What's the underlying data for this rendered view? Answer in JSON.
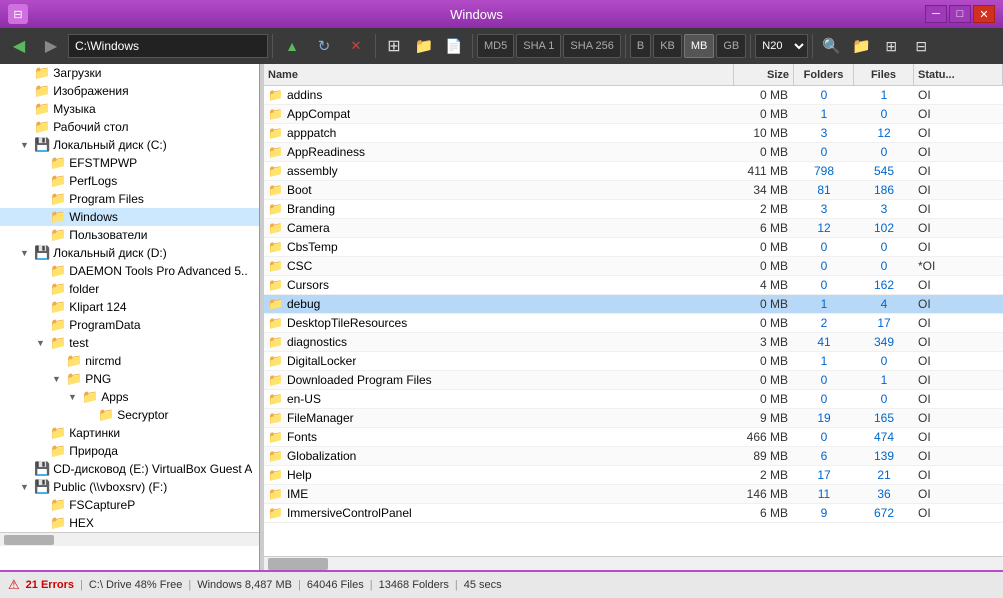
{
  "titlebar": {
    "title": "Windows",
    "min_btn": "─",
    "max_btn": "□",
    "close_btn": "✕"
  },
  "toolbar": {
    "address": "C:\\Windows",
    "back_icon": "◀",
    "forward_icon": "▶",
    "up_icon": "▲",
    "refresh_icon": "↻",
    "cancel_icon": "✕",
    "calc_icon": "▦",
    "folder_icon": "📁",
    "file_icon": "📄",
    "hash_md5": "MD5",
    "hash_sha1": "SHA 1",
    "hash_sha256": "SHA 256",
    "unit_b": "B",
    "unit_kb": "KB",
    "unit_mb": "MB",
    "unit_gb": "GB",
    "size_select": "N20",
    "search_icon": "🔍",
    "view1_icon": "⊞",
    "view2_icon": "≡",
    "view3_icon": "⊟"
  },
  "tree": {
    "items": [
      {
        "id": "downloads",
        "label": "Загрузки",
        "indent": 1,
        "arrow": "",
        "has_arrow": false
      },
      {
        "id": "images",
        "label": "Изображения",
        "indent": 1,
        "arrow": "",
        "has_arrow": false
      },
      {
        "id": "music",
        "label": "Музыка",
        "indent": 1,
        "arrow": "",
        "has_arrow": false
      },
      {
        "id": "desktop",
        "label": "Рабочий стол",
        "indent": 1,
        "arrow": "",
        "has_arrow": false
      },
      {
        "id": "local-c",
        "label": "Локальный диск (C:)",
        "indent": 1,
        "arrow": "▼",
        "has_arrow": true
      },
      {
        "id": "efstmpwp",
        "label": "EFSTMPWP",
        "indent": 2,
        "arrow": "",
        "has_arrow": false
      },
      {
        "id": "perflogs",
        "label": "PerfLogs",
        "indent": 2,
        "arrow": "",
        "has_arrow": false
      },
      {
        "id": "program-files",
        "label": "Program Files",
        "indent": 2,
        "arrow": "",
        "has_arrow": false
      },
      {
        "id": "windows",
        "label": "Windows",
        "indent": 2,
        "arrow": "",
        "has_arrow": false
      },
      {
        "id": "users",
        "label": "Пользователи",
        "indent": 2,
        "arrow": "",
        "has_arrow": false
      },
      {
        "id": "local-d",
        "label": "Локальный диск (D:)",
        "indent": 1,
        "arrow": "▼",
        "has_arrow": true
      },
      {
        "id": "daemon",
        "label": "DAEMON Tools Pro Advanced 5..",
        "indent": 2,
        "arrow": "",
        "has_arrow": false
      },
      {
        "id": "folder",
        "label": "folder",
        "indent": 2,
        "arrow": "",
        "has_arrow": false
      },
      {
        "id": "klipart",
        "label": "Klipart 124",
        "indent": 2,
        "arrow": "",
        "has_arrow": false
      },
      {
        "id": "programdata",
        "label": "ProgramData",
        "indent": 2,
        "arrow": "",
        "has_arrow": false
      },
      {
        "id": "test",
        "label": "test",
        "indent": 2,
        "arrow": "▼",
        "has_arrow": true
      },
      {
        "id": "nircmd",
        "label": "nircmd",
        "indent": 3,
        "arrow": "",
        "has_arrow": false
      },
      {
        "id": "png",
        "label": "PNG",
        "indent": 3,
        "arrow": "▼",
        "has_arrow": true
      },
      {
        "id": "apps",
        "label": "Apps",
        "indent": 4,
        "arrow": "▼",
        "has_arrow": true
      },
      {
        "id": "secryptor",
        "label": "Secryptor",
        "indent": 5,
        "arrow": "",
        "has_arrow": false
      },
      {
        "id": "kartinki",
        "label": "Картинки",
        "indent": 2,
        "arrow": "",
        "has_arrow": false
      },
      {
        "id": "priroda",
        "label": "Природа",
        "indent": 2,
        "arrow": "",
        "has_arrow": false
      },
      {
        "id": "cd-drive",
        "label": "CD-дисковод (E:) VirtualBox Guest A",
        "indent": 1,
        "arrow": "",
        "has_arrow": false
      },
      {
        "id": "public",
        "label": "Public (\\\\vboxsrv) (F:)",
        "indent": 1,
        "arrow": "▼",
        "has_arrow": true
      },
      {
        "id": "fscapturep",
        "label": "FSCaptureP",
        "indent": 2,
        "arrow": "",
        "has_arrow": false
      },
      {
        "id": "hex",
        "label": "HEX",
        "indent": 2,
        "arrow": "",
        "has_arrow": false
      }
    ]
  },
  "file_header": {
    "name": "Name",
    "size": "Size",
    "folders": "Folders",
    "files": "Files",
    "status": "Statu..."
  },
  "files": [
    {
      "name": "addins",
      "size": "0 MB",
      "folders": "0",
      "files": "1",
      "status": "OI",
      "selected": false
    },
    {
      "name": "AppCompat",
      "size": "0 MB",
      "folders": "1",
      "files": "0",
      "status": "OI",
      "selected": false
    },
    {
      "name": "apppatch",
      "size": "10 MB",
      "folders": "3",
      "files": "12",
      "status": "OI",
      "selected": false
    },
    {
      "name": "AppReadiness",
      "size": "0 MB",
      "folders": "0",
      "files": "0",
      "status": "OI",
      "selected": false
    },
    {
      "name": "assembly",
      "size": "411 MB",
      "folders": "798",
      "files": "545",
      "status": "OI",
      "selected": false
    },
    {
      "name": "Boot",
      "size": "34 MB",
      "folders": "81",
      "files": "186",
      "status": "OI",
      "selected": false
    },
    {
      "name": "Branding",
      "size": "2 MB",
      "folders": "3",
      "files": "3",
      "status": "OI",
      "selected": false
    },
    {
      "name": "Camera",
      "size": "6 MB",
      "folders": "12",
      "files": "102",
      "status": "OI",
      "selected": false
    },
    {
      "name": "CbsTemp",
      "size": "0 MB",
      "folders": "0",
      "files": "0",
      "status": "OI",
      "selected": false
    },
    {
      "name": "CSC",
      "size": "0 MB",
      "folders": "0",
      "files": "0",
      "status": "*OI",
      "selected": false
    },
    {
      "name": "Cursors",
      "size": "4 MB",
      "folders": "0",
      "files": "162",
      "status": "OI",
      "selected": false
    },
    {
      "name": "debug",
      "size": "0 MB",
      "folders": "1",
      "files": "4",
      "status": "OI",
      "selected": true
    },
    {
      "name": "DesktopTileResources",
      "size": "0 MB",
      "folders": "2",
      "files": "17",
      "status": "OI",
      "selected": false
    },
    {
      "name": "diagnostics",
      "size": "3 MB",
      "folders": "41",
      "files": "349",
      "status": "OI",
      "selected": false
    },
    {
      "name": "DigitalLocker",
      "size": "0 MB",
      "folders": "1",
      "files": "0",
      "status": "OI",
      "selected": false
    },
    {
      "name": "Downloaded Program Files",
      "size": "0 MB",
      "folders": "0",
      "files": "1",
      "status": "OI",
      "selected": false
    },
    {
      "name": "en-US",
      "size": "0 MB",
      "folders": "0",
      "files": "0",
      "status": "OI",
      "selected": false
    },
    {
      "name": "FileManager",
      "size": "9 MB",
      "folders": "19",
      "files": "165",
      "status": "OI",
      "selected": false
    },
    {
      "name": "Fonts",
      "size": "466 MB",
      "folders": "0",
      "files": "474",
      "status": "OI",
      "selected": false
    },
    {
      "name": "Globalization",
      "size": "89 MB",
      "folders": "6",
      "files": "139",
      "status": "OI",
      "selected": false
    },
    {
      "name": "Help",
      "size": "2 MB",
      "folders": "17",
      "files": "21",
      "status": "OI",
      "selected": false
    },
    {
      "name": "IME",
      "size": "146 MB",
      "folders": "11",
      "files": "36",
      "status": "OI",
      "selected": false
    },
    {
      "name": "ImmersiveControlPanel",
      "size": "6 MB",
      "folders": "9",
      "files": "672",
      "status": "OI",
      "selected": false
    }
  ],
  "statusbar": {
    "errors": "21 Errors",
    "drive_info": "C:\\ Drive 48% Free",
    "windows_size": "Windows 8,487 MB",
    "files_count": "64046 Files",
    "folders_count": "13468 Folders",
    "time": "45 secs"
  }
}
